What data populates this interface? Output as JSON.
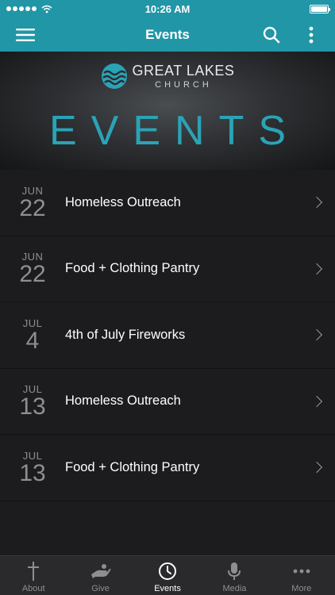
{
  "status_bar": {
    "time": "10:26 AM",
    "icons": [
      "signal-dots-icon",
      "wifi-icon",
      "battery-icon"
    ]
  },
  "nav": {
    "title": "Events",
    "left_icon": "hamburger-menu-icon",
    "right_icons": [
      "search-icon",
      "vertical-ellipsis-icon"
    ]
  },
  "hero": {
    "logo_main": "GREAT LAKES",
    "logo_sub": "CHURCH",
    "title": "EVENTS"
  },
  "events": [
    {
      "month": "JUN",
      "day": "22",
      "title": "Homeless Outreach"
    },
    {
      "month": "JUN",
      "day": "22",
      "title": "Food + Clothing Pantry"
    },
    {
      "month": "JUL",
      "day": "4",
      "title": "4th of July Fireworks"
    },
    {
      "month": "JUL",
      "day": "13",
      "title": "Homeless Outreach"
    },
    {
      "month": "JUL",
      "day": "13",
      "title": "Food + Clothing Pantry"
    }
  ],
  "tabs": [
    {
      "label": "About",
      "icon": "cross-icon",
      "active": false
    },
    {
      "label": "Give",
      "icon": "giving-hand-icon",
      "active": false
    },
    {
      "label": "Events",
      "icon": "clock-icon",
      "active": true
    },
    {
      "label": "Media",
      "icon": "microphone-icon",
      "active": false
    },
    {
      "label": "More",
      "icon": "horizontal-ellipsis-icon",
      "active": false
    }
  ],
  "colors": {
    "accent": "#2196a6",
    "hero_title": "#2aa3b6",
    "background": "#1c1c1e",
    "tab_bar": "#2a2a2c"
  }
}
